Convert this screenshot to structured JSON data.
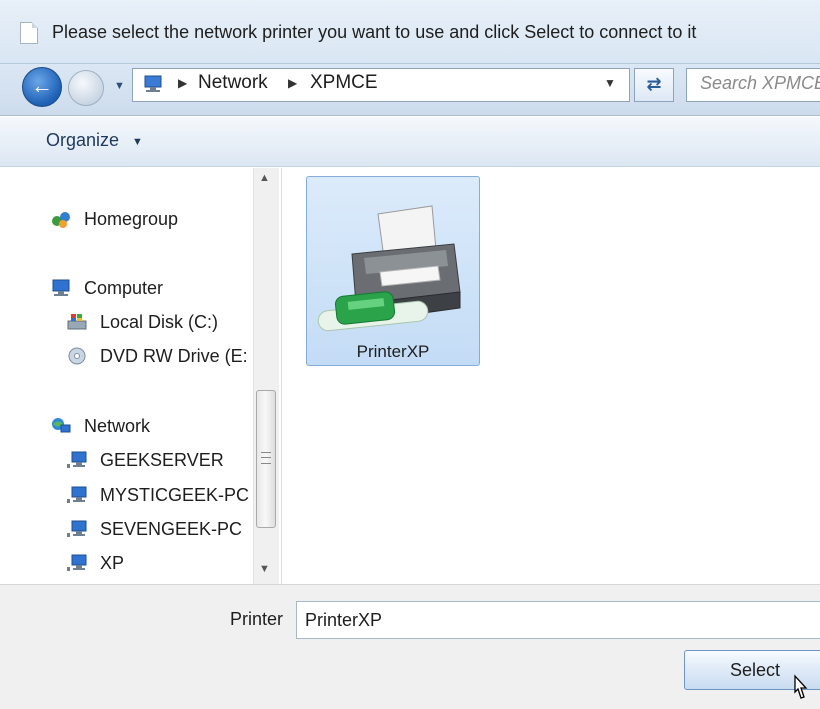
{
  "window": {
    "title": "Please select the network printer you want to use and click Select to connect to it"
  },
  "navigation": {
    "back_icon": "back-arrow-icon",
    "forward_icon": "forward-arrow-icon",
    "breadcrumb": [
      "Network",
      "XPMCE"
    ],
    "search_placeholder": "Search XPMCE"
  },
  "toolbar": {
    "organize_label": "Organize"
  },
  "sidebar": {
    "items": [
      {
        "label": "Homegroup",
        "icon": "homegroup-icon",
        "level": 0
      },
      {
        "label": "Computer",
        "icon": "computer-icon",
        "level": 0
      },
      {
        "label": "Local Disk (C:)",
        "icon": "local-disk-icon",
        "level": 1
      },
      {
        "label": "DVD RW Drive (E:",
        "icon": "dvd-drive-icon",
        "level": 1
      },
      {
        "label": "Network",
        "icon": "network-icon",
        "level": 0
      },
      {
        "label": "GEEKSERVER",
        "icon": "networked-computer-icon",
        "level": 1
      },
      {
        "label": "MYSTICGEEK-PC",
        "icon": "networked-computer-icon",
        "level": 1
      },
      {
        "label": "SEVENGEEK-PC",
        "icon": "networked-computer-icon",
        "level": 1
      },
      {
        "label": "XP",
        "icon": "networked-computer-icon",
        "level": 1
      }
    ]
  },
  "content": {
    "items": [
      {
        "label": "PrinterXP",
        "icon": "network-printer-icon",
        "selected": true
      }
    ]
  },
  "footer": {
    "printer_field_label": "Printer",
    "printer_field_value": "PrinterXP",
    "select_label": "Select"
  },
  "colors": {
    "titlebar": "#dde8f4",
    "selection": "#cde3f9",
    "selection_border": "#84acdd",
    "footer": "#f0f0f0"
  }
}
